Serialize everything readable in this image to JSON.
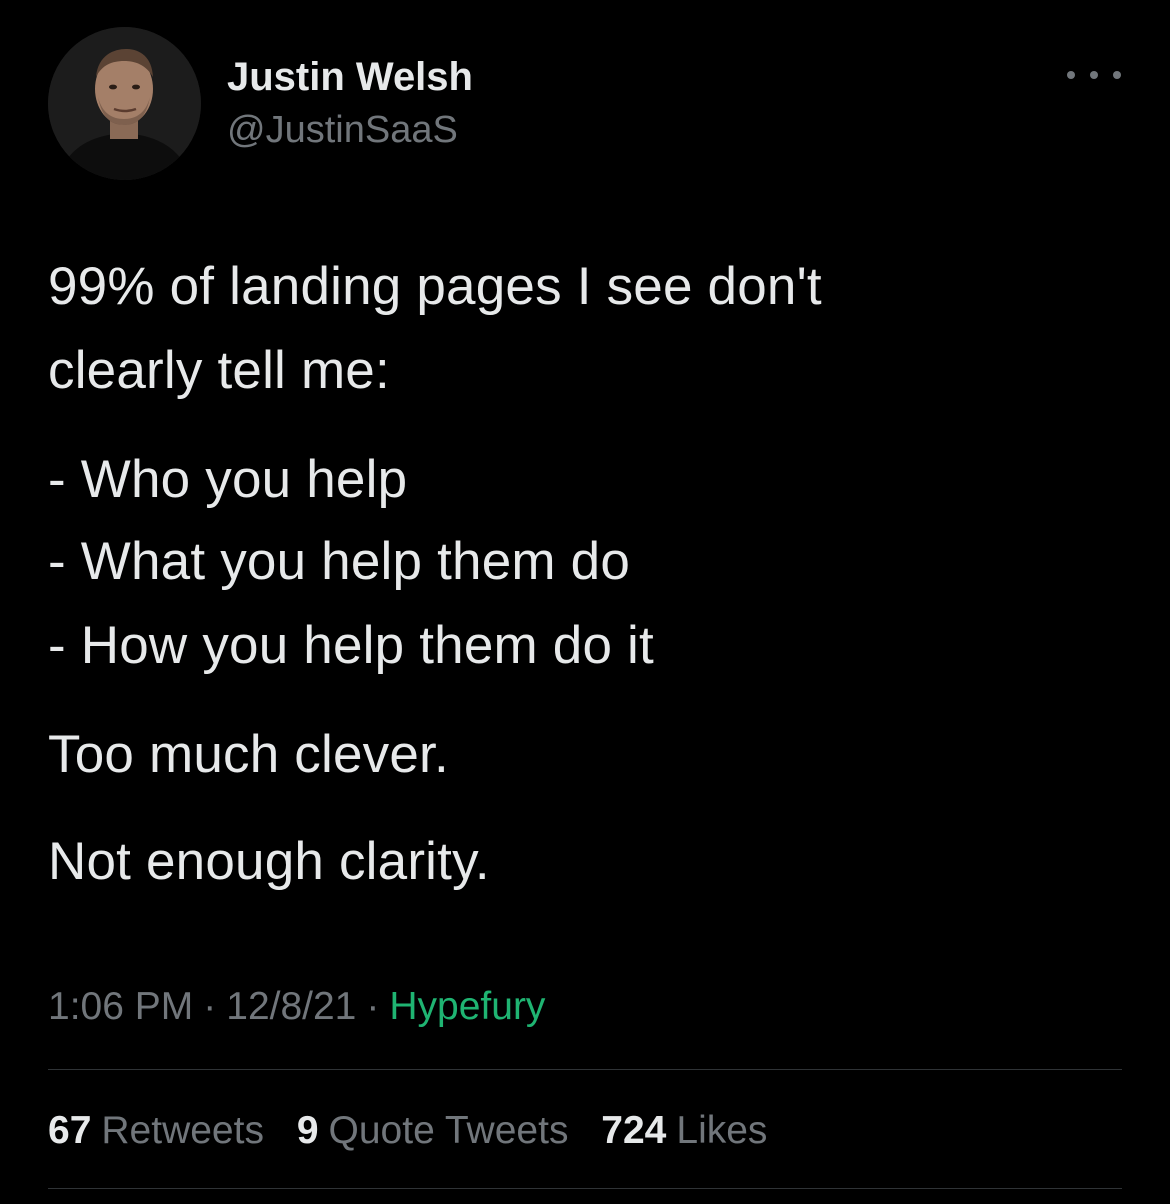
{
  "author": {
    "name": "Justin Welsh",
    "handle": "@JustinSaaS"
  },
  "tweet": {
    "lines": [
      "99% of landing pages I see don't",
      "clearly tell me:",
      "- Who you help",
      "- What you help them do",
      "- How you help them do it",
      "Too much clever.",
      "Not enough clarity."
    ],
    "time": "1:06 PM",
    "date": "12/8/21",
    "source": "Hypefury",
    "separator": "·"
  },
  "stats": {
    "retweets_count": "67",
    "retweets_label": "Retweets",
    "quotes_count": "9",
    "quotes_label": "Quote Tweets",
    "likes_count": "724",
    "likes_label": "Likes"
  },
  "icons": {
    "more": "more-icon"
  },
  "colors": {
    "background": "#000000",
    "text": "#e7e9ea",
    "secondary": "#71767b",
    "source_link": "#1fb472",
    "divider": "#2f3336"
  }
}
